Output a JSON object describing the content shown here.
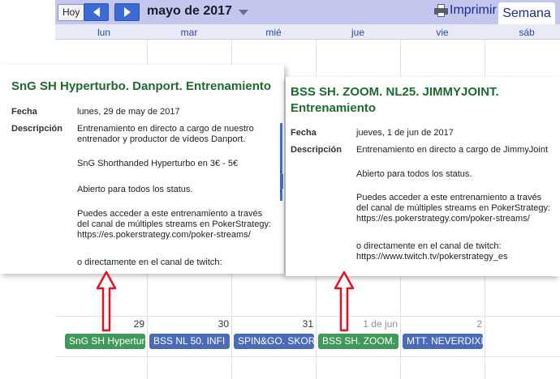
{
  "toolbar": {
    "today_label": "Hoy",
    "month_title": "mayo de 2017",
    "print_label": "Imprimir",
    "view_tab_label": "Semana"
  },
  "day_headers": [
    "lun",
    "mar",
    "mié",
    "jue",
    "vie",
    "sáb"
  ],
  "day_numbers": [
    "29",
    "30",
    "31",
    "1 de jun",
    "2"
  ],
  "events": [
    {
      "label": "SnG SH Hyperturbo",
      "color": "#3f9a59"
    },
    {
      "label": "BSS NL 50. INFI",
      "color": "#4a6bb5"
    },
    {
      "label": "SPIN&GO. SKORPIO",
      "color": "#4a6bb5"
    },
    {
      "label": "BSS SH. ZOOM. N",
      "color": "#3f9a59"
    },
    {
      "label": "MTT. NEVERDIXIE",
      "color": "#4a6bb5"
    }
  ],
  "popup_left": {
    "title": "SnG SH Hyperturbo. Danport. Entrenamiento",
    "fecha_label": "Fecha",
    "fecha_value": "lunes, 29 de may de 2017",
    "desc_label": "Descripción",
    "desc_lines": [
      "Entrenamiento en directo a cargo de nuestro\nentrenador y productor de vídeos Danport.",
      "SnG Shorthanded Hyperturbo en 3€ - 5€",
      "Abierto para todos los status.",
      "Puedes acceder a este entrenamiento a través\ndel canal de múltiples streams en PokerStrategy:\nhttps://es.pokerstrategy.com/poker-streams/",
      "o directamente en el canal de twitch:"
    ]
  },
  "popup_right": {
    "title": "BSS SH. ZOOM. NL25. JIMMYJOINT.\nEntrenamiento",
    "fecha_label": "Fecha",
    "fecha_value": "jueves, 1 de jun de 2017",
    "desc_label": "Descripción",
    "desc_lines": [
      "Entrenamiento en directo a cargo de JimmyJoint",
      "Abierto para todos los status.",
      "Puedes acceder a este entrenamiento a través\ndel canal de múltiples streams en PokerStrategy:\nhttps://es.pokerstrategy.com/poker-streams/",
      "o directamente en el canal de twitch:\nhttps://www.twitch.tv/pokerstrategy_es"
    ]
  },
  "colors": {
    "toolbar_bg": "#c3c7ee",
    "nav_blue": "#3d6bd6",
    "event_green": "#3f9a59",
    "event_blue": "#4a6bb5",
    "title_green": "#1d6b2e",
    "arrow_red": "#e0141e"
  },
  "icons": [
    "chevron-left-icon",
    "chevron-right-icon",
    "caret-down-icon",
    "printer-icon",
    "arrow-up-icon"
  ]
}
